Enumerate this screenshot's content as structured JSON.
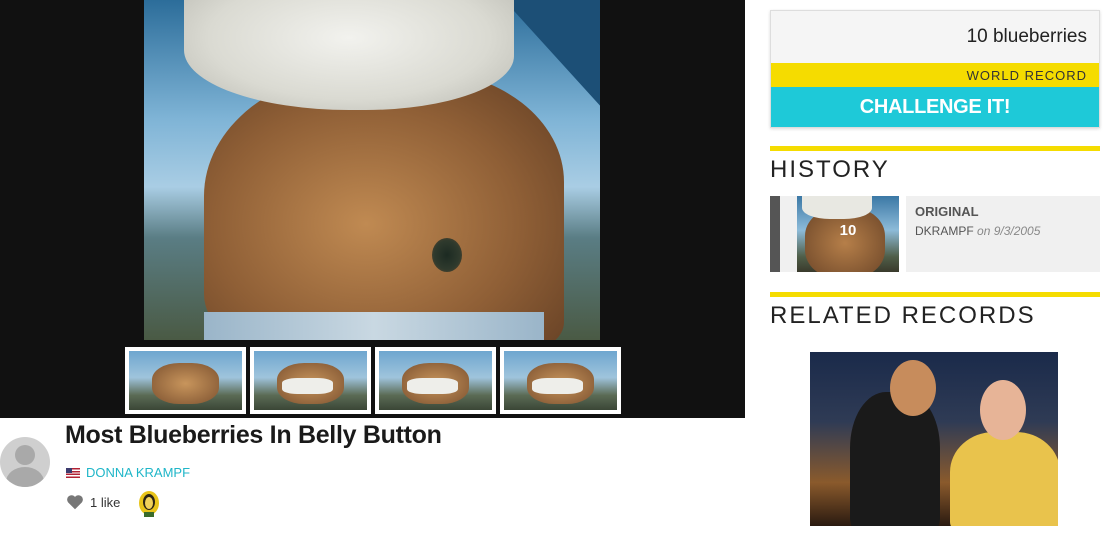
{
  "record": {
    "title": "Most Blueberries In Belly Button",
    "holder": "DONNA KRAMPF",
    "likes": "1 like",
    "value": "10 blueberries",
    "badge": "WORLD RECORD",
    "challenge_label": "CHALLENGE IT!"
  },
  "history": {
    "title": "HISTORY",
    "items": [
      {
        "count": "10",
        "label": "ORIGINAL",
        "user": "DKRAMPF",
        "date": "on 9/3/2005"
      }
    ]
  },
  "related": {
    "title": "RELATED RECORDS"
  },
  "icons": {
    "heart": "heart-icon",
    "flag": "us-flag-icon",
    "avatar": "user-avatar-icon"
  },
  "colors": {
    "accent_cyan": "#1ec9d8",
    "accent_yellow": "#f5dc00",
    "link": "#1fb6c8"
  }
}
